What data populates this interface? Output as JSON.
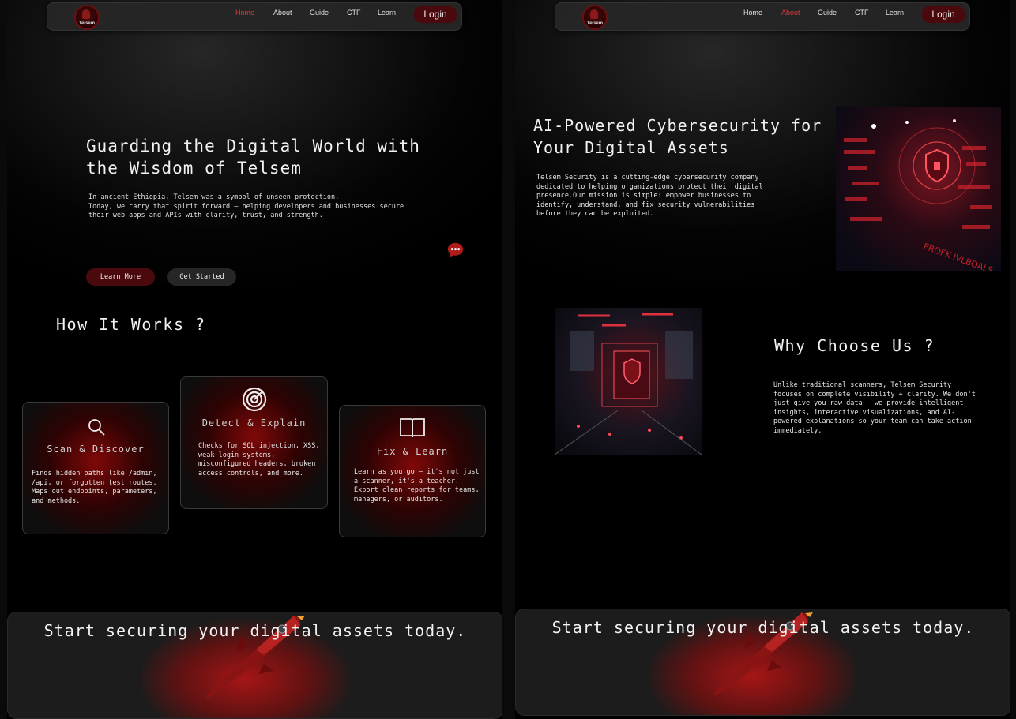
{
  "nav": {
    "logo_text": "Telsem",
    "items": [
      "Home",
      "About",
      "Guide",
      "CTF",
      "Learn"
    ],
    "login": "Login"
  },
  "home": {
    "active": "Home",
    "hero_title": "Guarding the Digital World with the Wisdom of Telsem",
    "hero_text": "In ancient Ethiopia, Telsem was a symbol of unseen protection.\n Today, we carry that spirit forward — helping developers and businesses secure their web apps and APIs with clarity, trust, and strength.",
    "learn_more": "Learn More",
    "get_started": "Get Started",
    "how_title": "How It Works ?",
    "cards": [
      {
        "title": "Scan & Discover",
        "text": "Finds hidden paths like /admin, /api, or forgotten test routes. Maps out endpoints, parameters, and methods.",
        "icon": "search-icon"
      },
      {
        "title": "Detect & Explain",
        "text": "Checks for SQL injection, XSS, weak login systems, misconfigured headers, broken access controls, and more.",
        "icon": "target-icon"
      },
      {
        "title": "Fix & Learn",
        "text": "Learn as you go — it's not just a scanner, it's a teacher. Export clean reports for teams, managers, or auditors.",
        "icon": "book-icon"
      }
    ],
    "cta": "Start securing your digital assets today."
  },
  "about": {
    "active": "About",
    "title": "AI-Powered Cybersecurity for Your Digital Assets",
    "text": "Telsem Security is a cutting-edge cybersecurity company dedicated to helping organizations protect their digital presence.Our mission is simple: empower businesses to identify, understand, and fix security vulnerabilities before they can be exploited.",
    "why_title": "Why Choose Us ?",
    "why_text": "Unlike traditional scanners, Telsem Security focuses on complete visibility + clarity. We don't just give you raw data — we provide intelligent insights, interactive visualizations, and AI-powered explanations so your team can take action immediately.",
    "cta": "Start securing your digital assets today."
  },
  "colors": {
    "accent": "#d63b3b",
    "button_red": "#4a0a0d",
    "background": "#000000"
  }
}
